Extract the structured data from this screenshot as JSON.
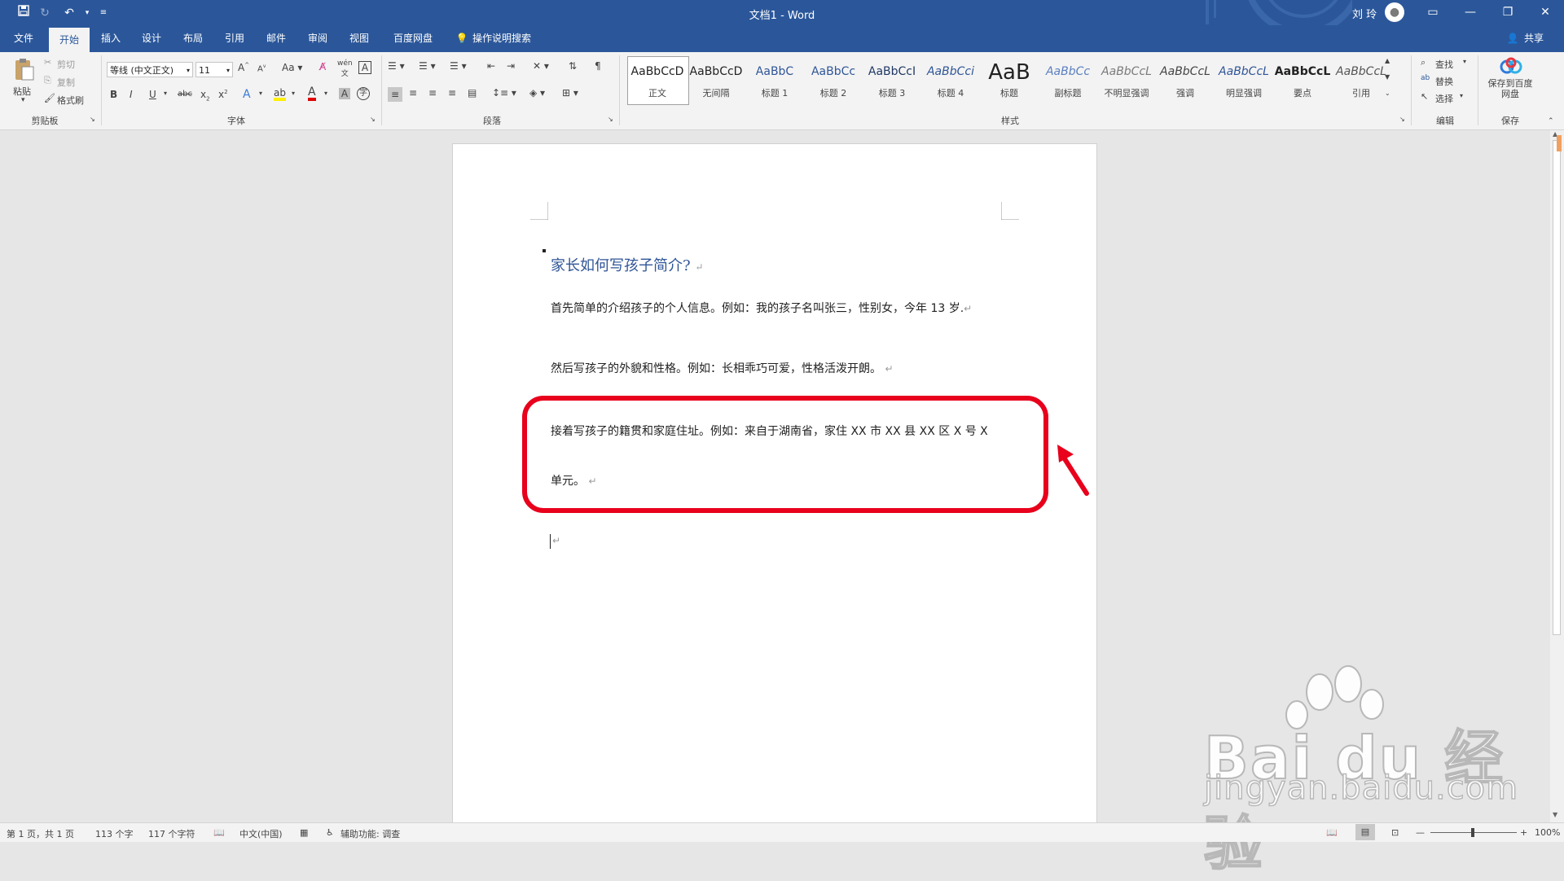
{
  "window": {
    "doc_title": "文档1  -  Word",
    "user": "刘 玲"
  },
  "tabs": [
    "文件",
    "开始",
    "插入",
    "设计",
    "布局",
    "引用",
    "邮件",
    "审阅",
    "视图",
    "百度网盘"
  ],
  "active_tab": "开始",
  "tell_me": "操作说明搜索",
  "share": "共享",
  "clipboard": {
    "paste": "粘贴",
    "cut": "剪切",
    "copy": "复制",
    "format_painter": "格式刷",
    "label": "剪贴板"
  },
  "font": {
    "name": "等线 (中文正文)",
    "size": "11",
    "label": "字体"
  },
  "paragraph": {
    "label": "段落"
  },
  "styles": {
    "label": "样式",
    "items": [
      {
        "sample": "AaBbCcD",
        "name": "正文"
      },
      {
        "sample": "AaBbCcD",
        "name": "无间隔"
      },
      {
        "sample": "AaBbC",
        "name": "标题 1"
      },
      {
        "sample": "AaBbCc",
        "name": "标题 2"
      },
      {
        "sample": "AaBbCcI",
        "name": "标题 3"
      },
      {
        "sample": "AaBbCci",
        "name": "标题 4"
      },
      {
        "sample": "AaB",
        "name": "标题"
      },
      {
        "sample": "AaBbCc",
        "name": "副标题"
      },
      {
        "sample": "AaBbCcL",
        "name": "不明显强调"
      },
      {
        "sample": "AaBbCcL",
        "name": "强调"
      },
      {
        "sample": "AaBbCcL",
        "name": "明显强调"
      },
      {
        "sample": "AaBbCcL",
        "name": "要点"
      },
      {
        "sample": "AaBbCcL",
        "name": "引用"
      }
    ]
  },
  "editing": {
    "find": "查找",
    "replace": "替换",
    "select": "选择",
    "label": "编辑"
  },
  "save_group": {
    "button": "保存到百度网盘",
    "label": "保存"
  },
  "document": {
    "heading": "家长如何写孩子简介?",
    "p1": "首先简单的介绍孩子的个人信息。例如：我的孩子名叫张三，性别女，今年 13 岁.",
    "p2": "然后写孩子的外貌和性格。例如：长相乖巧可爱，性格活泼开朗。",
    "p3_line1": "接着写孩子的籍贯和家庭住址。例如：来自于湖南省，家住 XX 市 XX 县 XX 区 X 号 X",
    "p3_line2": "单元。",
    "para_mark": "↵"
  },
  "status": {
    "page": "第 1 页，共 1 页",
    "words": "113 个字",
    "chars": "117 个字符",
    "language": "中文(中国)",
    "accessibility": "辅助功能: 调查",
    "zoom": "100%"
  },
  "watermark": {
    "line1": "Bai du 经验",
    "line2": "jingyan.baidu.com"
  },
  "colors": {
    "accent": "#2b579a",
    "highlight": "#e8001c",
    "heading": "#2f5597"
  }
}
